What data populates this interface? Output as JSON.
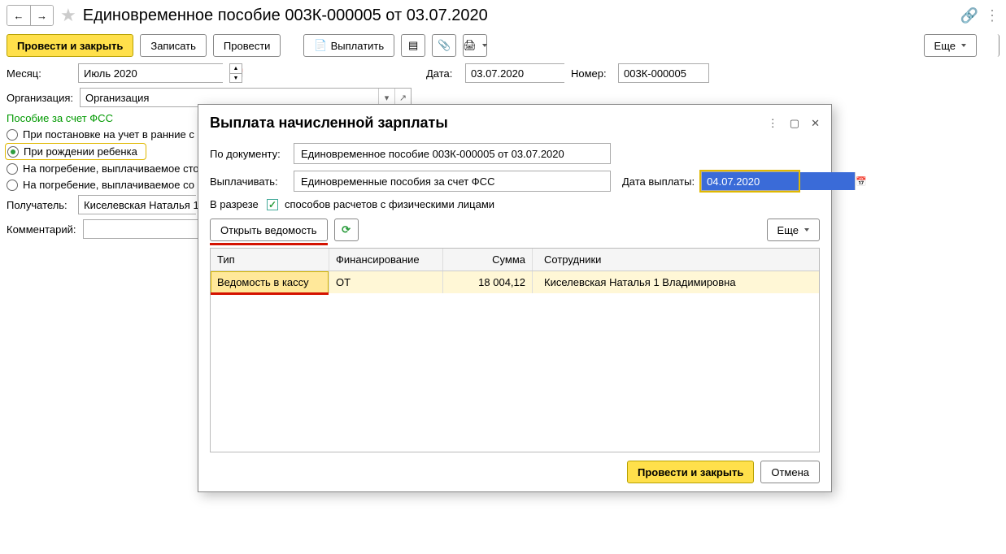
{
  "page": {
    "title": "Единовременное пособие 003К-000005 от 03.07.2020"
  },
  "toolbar": {
    "process_close": "Провести и закрыть",
    "save": "Записать",
    "process": "Провести",
    "payout": "Выплатить",
    "more": "Еще"
  },
  "form": {
    "month_label": "Месяц:",
    "month_value": "Июль 2020",
    "date_label": "Дата:",
    "date_value": "03.07.2020",
    "number_label": "Номер:",
    "number_value": "003К-000005",
    "org_label": "Организация:",
    "org_value": "Организация",
    "recipient_label": "Получатель:",
    "recipient_value": "Киселевская Наталья 1",
    "comment_label": "Комментарий:",
    "comment_value": ""
  },
  "fss": {
    "header": "Пособие за счет ФСС",
    "opt1": "При постановке на учет в ранние с",
    "opt2": "При рождении ребенка",
    "opt3": "На погребение, выплачиваемое сто",
    "opt4": "На погребение, выплачиваемое со"
  },
  "modal": {
    "title": "Выплата начисленной зарплаты",
    "doc_label": "По документу:",
    "doc_value": "Единовременное пособие 003К-000005 от 03.07.2020",
    "pay_label": "Выплачивать:",
    "pay_value": "Единовременные пособия за счет ФСС",
    "paydate_label": "Дата выплаты:",
    "paydate_value": "04.07.2020",
    "cut_label": "В разрезе",
    "cut_check": "способов расчетов с физическими лицами",
    "open_ved": "Открыть ведомость",
    "more": "Еще",
    "process_close": "Провести и закрыть",
    "cancel": "Отмена"
  },
  "table": {
    "head": {
      "type": "Тип",
      "fin": "Финансирование",
      "sum": "Сумма",
      "emp": "Сотрудники"
    },
    "row": {
      "type": "Ведомость в кассу",
      "fin": "ОТ",
      "sum": "18 004,12",
      "emp": "Киселевская Наталья 1 Владимировна"
    }
  }
}
